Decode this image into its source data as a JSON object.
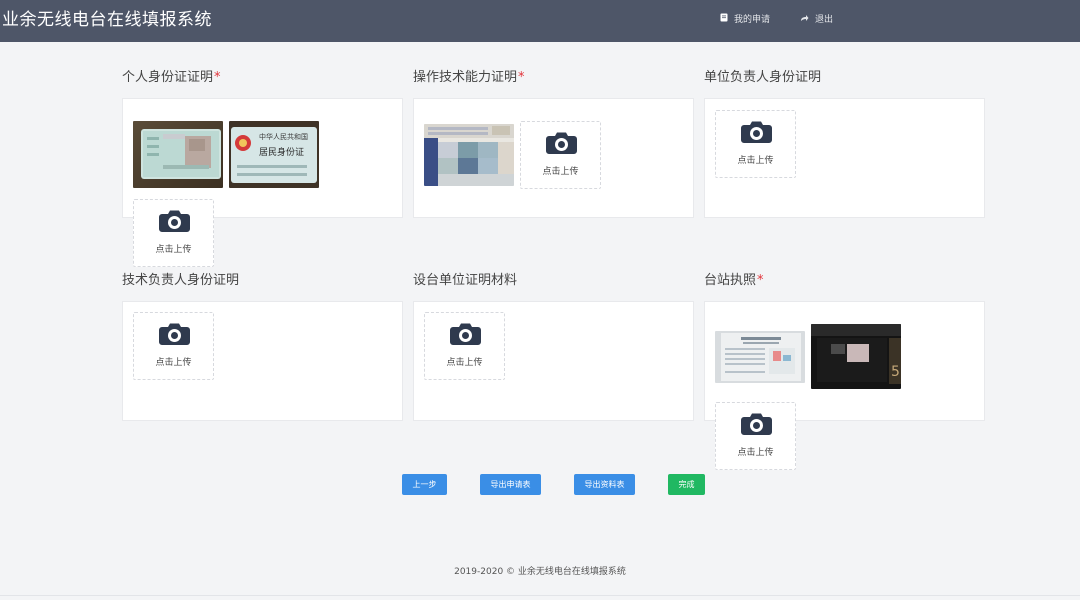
{
  "header": {
    "app_title": "业余无线电台在线填报系统",
    "nav": {
      "my_applications": "我的申请",
      "logout": "退出"
    },
    "nav_icons": {
      "my_applications": "document-icon",
      "logout": "share-arrow-icon"
    }
  },
  "upload": {
    "tile_label": "点击上传",
    "tile_icon": "camera-icon",
    "required_mark": "*"
  },
  "sections": [
    {
      "label": "个人身份证证明",
      "required": true,
      "images": [
        "id-card-back",
        "id-card-front"
      ]
    },
    {
      "label": "操作技术能力证明",
      "required": true,
      "images": [
        "operator-certificate"
      ]
    },
    {
      "label": "单位负责人身份证明",
      "required": false,
      "images": []
    },
    {
      "label": "技术负责人身份证明",
      "required": false,
      "images": []
    },
    {
      "label": "设台单位证明材料",
      "required": false,
      "images": []
    },
    {
      "label": "台站执照",
      "required": true,
      "images": [
        "station-license-document",
        "station-equipment-photo"
      ]
    }
  ],
  "actions": {
    "prev": "上一步",
    "export_application": "导出申请表",
    "export_materials": "导出资料表",
    "finish": "完成"
  },
  "colors": {
    "header_bg": "#4e5668",
    "primary": "#3a8ee6",
    "success": "#20b862",
    "required": "#e2333a",
    "page_bg": "#f3f4f6"
  },
  "footer": {
    "text": "2019-2020 © 业余无线电台在线填报系统"
  }
}
